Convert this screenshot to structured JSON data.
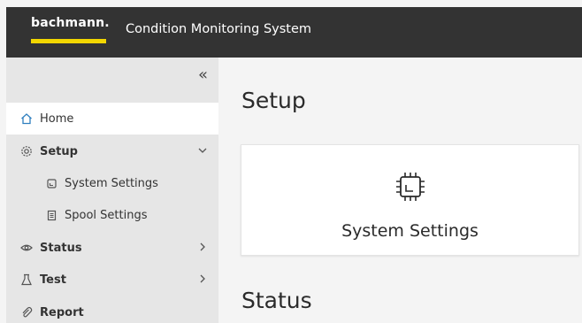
{
  "header": {
    "brand": "bachmann.",
    "title": "Condition Monitoring System",
    "brand_color": "#f2d600"
  },
  "sidebar": {
    "collapse_glyph": "«",
    "items": [
      {
        "label": "Home",
        "icon": "home-icon"
      },
      {
        "label": "Setup",
        "icon": "gear-icon"
      },
      {
        "label": "System Settings",
        "icon": "chip-icon"
      },
      {
        "label": "Spool Settings",
        "icon": "document-icon"
      },
      {
        "label": "Status",
        "icon": "eye-icon"
      },
      {
        "label": "Test",
        "icon": "flask-icon"
      },
      {
        "label": "Report",
        "icon": "paperclip-icon"
      }
    ]
  },
  "main": {
    "sections": [
      {
        "title": "Setup"
      },
      {
        "title": "Status"
      }
    ],
    "card": {
      "label": "System Settings",
      "icon": "chip-icon"
    }
  }
}
